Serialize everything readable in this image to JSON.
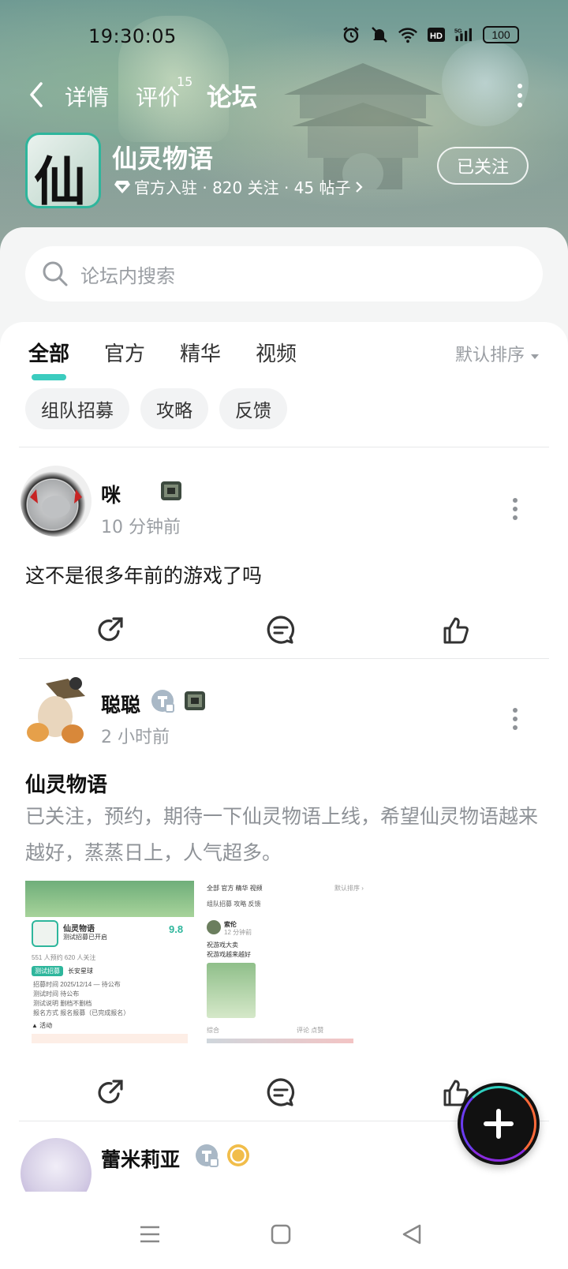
{
  "status_bar": {
    "time": "19:30:05",
    "battery": "100",
    "icons": [
      "alarm-icon",
      "mute-icon",
      "wifi-icon",
      "hd-icon",
      "signal-5g-icon"
    ]
  },
  "nav": {
    "tabs": [
      {
        "label": "详情"
      },
      {
        "label": "评价",
        "badge": "15"
      },
      {
        "label": "论坛"
      }
    ],
    "active_tab": "论坛"
  },
  "game": {
    "name": "仙灵物语",
    "icon_char": "仙",
    "meta": "官方入驻 · 820 关注 · 45 帖子",
    "follow_label": "已关注"
  },
  "search": {
    "placeholder": "论坛内搜索"
  },
  "filters": {
    "tabs": [
      "全部",
      "官方",
      "精华",
      "视频"
    ],
    "active": "全部",
    "sort_label": "默认排序"
  },
  "chips": [
    "组队招募",
    "攻略",
    "反馈"
  ],
  "posts": [
    {
      "user": "咪",
      "time": "10 分钟前",
      "text": "这不是很多年前的游戏了吗"
    },
    {
      "user": "聪聪",
      "time": "2 小时前",
      "title": "仙灵物语",
      "body": "已关注，预约，期待一下仙灵物语上线，希望仙灵物语越来越好，蒸蒸日上，人气超多。",
      "thumb1": {
        "game": "仙灵物语",
        "sub": "测试招募已开启",
        "score": "9.8",
        "follow": "551 人预约     620 人关注",
        "server_tag": "测试招募",
        "server": "长安星球",
        "rows": [
          "招募时间      2025/12/14 — 待公布",
          "测试时间      待公布",
          "测试说明      删档不删档",
          "报名方式      报名报募（已完成报名）"
        ],
        "activity": "▲ 活动"
      },
      "thumb2": {
        "tabs": "全部   官方   精华   视频",
        "sort": "默认排序 ›",
        "chips": "组队招募    攻略    反馈",
        "user": "索伦",
        "time": "12 分钟前",
        "text1": "祝游戏大卖",
        "text2": "祝游戏越来越好",
        "tag": "综合",
        "actions": "评论   点赞"
      }
    },
    {
      "user": "蕾米莉亚"
    }
  ]
}
